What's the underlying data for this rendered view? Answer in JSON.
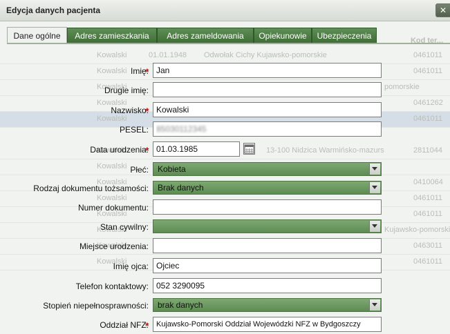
{
  "window": {
    "title": "Edycja danych pacjenta",
    "close_label": "✕"
  },
  "tabs": [
    {
      "label": "Dane ogólne",
      "active": true
    },
    {
      "label": "Adres zamieszkania",
      "active": false
    },
    {
      "label": "Adres zameldowania",
      "active": false
    },
    {
      "label": "Opiekunowie",
      "active": false
    },
    {
      "label": "Ubezpieczenia",
      "active": false
    }
  ],
  "background": {
    "column_header": "Kod ter...",
    "rows": [
      {
        "cols": [
          "Kowalski",
          "01.01.1948",
          "Odwołak Cichy Kujawsko-pomorskie",
          "0461011"
        ]
      },
      {
        "cols": [
          "Kowalski",
          "0461011"
        ]
      },
      {
        "cols": [
          "Kowalski",
          "ujawsko-pomorskie",
          "pomorskie"
        ]
      },
      {
        "cols": [
          "Kowalski",
          "",
          "0461262"
        ]
      },
      {
        "cols": [
          "Kowalski",
          "0461011"
        ]
      },
      {
        "cols": [
          "Kowalski",
          "13-100 Nidzica Warmińsko-mazurs",
          "2811044"
        ]
      },
      {
        "cols": [
          "Kowalski"
        ]
      },
      {
        "cols": [
          "Kowalski",
          "0410064"
        ]
      },
      {
        "cols": [
          "Kowalski",
          "0461011"
        ]
      },
      {
        "cols": [
          "Kowalski",
          "0461011"
        ]
      },
      {
        "cols": [
          "Kowalski",
          "Kujawsko-pomorskie"
        ]
      },
      {
        "cols": [
          "Kowalski",
          "0463011"
        ]
      },
      {
        "cols": [
          "Kowalski",
          "0461011"
        ]
      }
    ]
  },
  "form": {
    "imie": {
      "label": "Imię:",
      "value": "Jan",
      "required": true
    },
    "drugie_imie": {
      "label": "Drugie imię:",
      "value": ""
    },
    "nazwisko": {
      "label": "Nazwisko:",
      "value": "Kowalski",
      "required": true
    },
    "pesel": {
      "label": "PESEL:",
      "value": "85030112345"
    },
    "data_urodzenia": {
      "label": "Data urodzenia:",
      "value": "01.03.1985",
      "required": true
    },
    "plec": {
      "label": "Płeć:",
      "value": "Kobieta"
    },
    "rodzaj_dokumentu": {
      "label": "Rodzaj dokumentu tożsamości:",
      "value": "Brak danych"
    },
    "numer_dokumentu": {
      "label": "Numer dokumentu:",
      "value": ""
    },
    "stan_cywilny": {
      "label": "Stan cywilny:",
      "value": ""
    },
    "miejsce_urodzenia": {
      "label": "Miejsce urodzenia:",
      "value": ""
    },
    "imie_ojca": {
      "label": "Imię ojca:",
      "value": "Ojciec"
    },
    "telefon": {
      "label": "Telefon kontaktowy:",
      "value": "052 3290095"
    },
    "stopien": {
      "label": "Stopień niepełnosprawności:",
      "value": "brak danych"
    },
    "oddzial_nfz": {
      "label": "Oddział NFZ:",
      "value": "Kujawsko-Pomorski Oddział Wojewódzki NFZ w Bydgoszczy",
      "required": true
    }
  },
  "icons": {
    "required": "required-asterisk-icon",
    "calendar": "calendar-icon",
    "dropdown": "chevron-down-icon",
    "close": "close-icon"
  }
}
